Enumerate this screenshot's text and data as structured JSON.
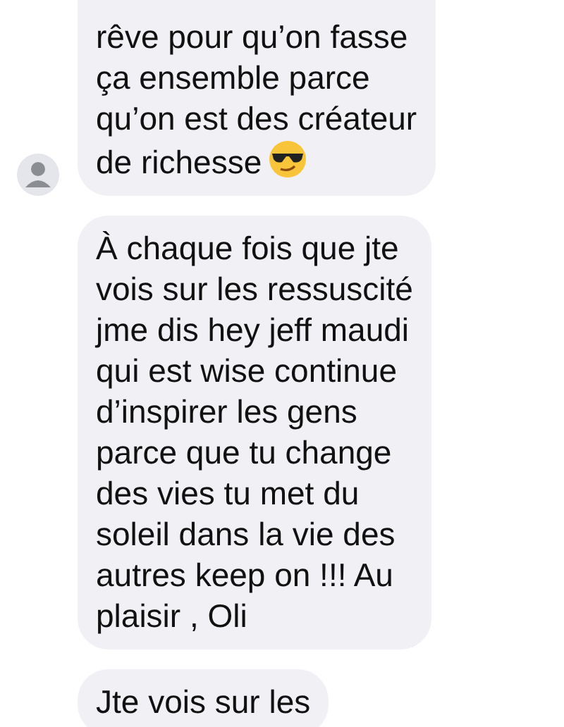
{
  "messages": [
    {
      "lines": [
        "rêve pour qu’on fasse",
        "ça ensemble parce",
        "qu’on est des créateur",
        "de richesse"
      ],
      "emoji": true,
      "avatar": true
    },
    {
      "lines": [
        "À chaque fois que jte",
        "vois sur les ressuscité",
        "jme dis hey jeff maudi",
        "qui est wise continue",
        "d’inspirer les gens",
        "parce que tu change",
        "des vies tu met du",
        "soleil dans la vie des",
        "autres keep on !!! Au",
        "plaisir , Oli"
      ],
      "emoji": false,
      "avatar": false
    },
    {
      "lines": [
        "Jte vois sur les"
      ],
      "emoji": false,
      "avatar": false
    }
  ]
}
